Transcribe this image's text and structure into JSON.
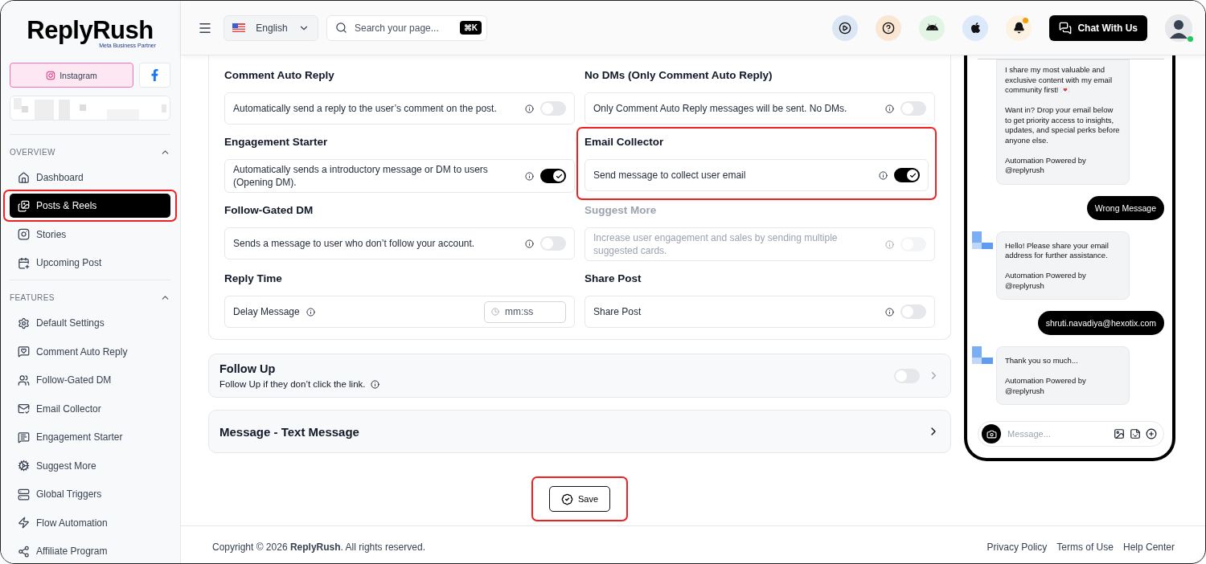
{
  "sidebar": {
    "logo": "ReplyRush",
    "partner": "Meta Business Partner",
    "platforms": [
      {
        "label": "Instagram",
        "selected": true
      },
      {
        "selected": false
      }
    ],
    "sections": [
      {
        "title": "OVERVIEW",
        "expanded": true,
        "items": [
          {
            "label": "Dashboard",
            "selected": false,
            "highlighted": false
          },
          {
            "label": "Posts & Reels",
            "selected": true,
            "highlighted": true
          },
          {
            "label": "Stories",
            "selected": false,
            "highlighted": false
          },
          {
            "label": "Upcoming Post",
            "selected": false,
            "highlighted": false
          }
        ]
      },
      {
        "title": "FEATURES",
        "expanded": true,
        "items": [
          {
            "label": "Default Settings",
            "selected": false,
            "highlighted": false
          },
          {
            "label": "Comment Auto Reply",
            "selected": false,
            "highlighted": false
          },
          {
            "label": "Follow-Gated DM",
            "selected": false,
            "highlighted": false
          },
          {
            "label": "Email Collector",
            "selected": false,
            "highlighted": false
          },
          {
            "label": "Engagement Starter",
            "selected": false,
            "highlighted": false
          },
          {
            "label": "Suggest More",
            "selected": false,
            "highlighted": false
          },
          {
            "label": "Global Triggers",
            "selected": false,
            "highlighted": false
          },
          {
            "label": "Flow Automation",
            "selected": false,
            "highlighted": false
          },
          {
            "label": "Affiliate Program",
            "selected": false,
            "highlighted": false
          }
        ]
      }
    ]
  },
  "header": {
    "language": "English",
    "search_placeholder": "Search your page...",
    "shortcut": "⌘K",
    "notification": true,
    "chat_button": "Chat With Us",
    "online": true
  },
  "settings": [
    {
      "kind": "toggle",
      "title": "Comment Auto Reply",
      "description": "Automatically send a reply to the user’s comment on the post.",
      "on": false,
      "disabled": false,
      "highlighted": false
    },
    {
      "kind": "toggle",
      "title": "No DMs (Only Comment Auto Reply)",
      "description": "Only Comment Auto Reply messages will be sent. No DMs.",
      "on": false,
      "disabled": false,
      "highlighted": false
    },
    {
      "kind": "toggle",
      "title": "Engagement Starter",
      "description": "Automatically sends a introductory message or DM to users (Opening DM).",
      "on": true,
      "disabled": false,
      "highlighted": false
    },
    {
      "kind": "toggle",
      "title": "Email Collector",
      "description": "Send message to collect user email",
      "on": true,
      "disabled": false,
      "highlighted": true
    },
    {
      "kind": "toggle",
      "title": "Follow-Gated DM",
      "description": "Sends a message to user who don’t follow your account.",
      "on": false,
      "disabled": false,
      "highlighted": false
    },
    {
      "kind": "toggle",
      "title": "Suggest More",
      "description": "Increase user engagement and sales by sending multiple suggested cards.",
      "on": false,
      "disabled": true,
      "highlighted": false
    },
    {
      "kind": "time",
      "title": "Reply Time",
      "description": "Delay Message",
      "placeholder": "mm:ss",
      "disabled": false,
      "highlighted": false
    },
    {
      "kind": "toggle",
      "title": "Share Post",
      "description": "Share Post",
      "on": false,
      "disabled": false,
      "highlighted": false
    }
  ],
  "follow_up": {
    "title": "Follow Up",
    "description": "Follow Up if they don’t click the link.",
    "on": false
  },
  "message_section": {
    "title": "Message - Text Message"
  },
  "save": {
    "label": "Save",
    "highlighted": true
  },
  "preview": {
    "messages": [
      {
        "kind": "received",
        "avatar": false,
        "text": "I share my most valuable and exclusive content with my email community first! 💌\n\nWant in? Drop your email below to get priority access to insights, updates, and special perks before anyone else.\n\nAutomation Powered by\n@replyrush"
      },
      {
        "kind": "sent",
        "text": "Wrong Message"
      },
      {
        "kind": "received",
        "avatar": true,
        "text": "Hello! Please share your email address for further assistance.\n\nAutomation Powered by\n@replyrush"
      },
      {
        "kind": "sent",
        "text": "shruti.navadiya@hexotix.com"
      },
      {
        "kind": "received",
        "avatar": true,
        "text": "Thank you so much...\n\nAutomation Powered by\n@replyrush"
      }
    ],
    "composer_placeholder": "Message..."
  },
  "footer": {
    "copyright": "Copyright © 2026 **ReplyRush**. All rights reserved.",
    "links": [
      "Privacy Policy",
      "Terms of Use",
      "Help Center"
    ]
  }
}
